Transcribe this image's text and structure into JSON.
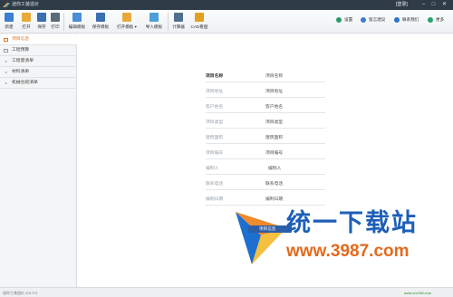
{
  "window": {
    "title": "迷你工装造价",
    "login": "[登录]",
    "controls": {
      "minimize": "–",
      "maximize": "□",
      "close": "✕"
    }
  },
  "toolbar": {
    "buttons": [
      {
        "label": "新建",
        "icon": "new-file-icon",
        "color": "#3c7fd0"
      },
      {
        "label": "打开",
        "icon": "folder-open-icon",
        "color": "#e8a93a"
      },
      {
        "label": "保存",
        "icon": "save-icon",
        "color": "#3a6fb0"
      },
      {
        "label": "打印",
        "icon": "printer-icon",
        "color": "#5b6b7a"
      },
      {
        "label": "编辑模板",
        "icon": "edit-template-icon",
        "color": "#4a8ed6"
      },
      {
        "label": "保存模板",
        "icon": "save-template-icon",
        "color": "#3a6fb0"
      },
      {
        "label": "打开模板 ▾",
        "icon": "open-template-icon",
        "color": "#e8a93a"
      },
      {
        "label": "导入模板",
        "icon": "import-template-icon",
        "color": "#4aa0d8"
      },
      {
        "label": "计算器",
        "icon": "calculator-icon",
        "color": "#4f6f8f"
      },
      {
        "label": "CAD看图",
        "icon": "cad-viewer-icon",
        "color": "#e0a020"
      }
    ],
    "right_links": [
      {
        "label": "设置",
        "icon": "gear-icon",
        "color": "#2e9a6a"
      },
      {
        "label": "留言建议",
        "icon": "message-icon",
        "color": "#3a7fc8"
      },
      {
        "label": "联系我们",
        "icon": "contact-icon",
        "color": "#2b74c9"
      },
      {
        "label": "更多",
        "icon": "more-icon",
        "color": "#26a36a"
      }
    ]
  },
  "sidebar": {
    "items": [
      {
        "label": "项目信息",
        "active": true,
        "kind": "page"
      },
      {
        "label": "工程预算",
        "active": false,
        "kind": "page"
      },
      {
        "label": "工程量清单",
        "active": false,
        "kind": "group"
      },
      {
        "label": "材料清单",
        "active": false,
        "kind": "group"
      },
      {
        "label": "机械台班清单",
        "active": false,
        "kind": "group"
      }
    ]
  },
  "form": {
    "rows": [
      {
        "label": "项目名称",
        "value": "项目名称"
      },
      {
        "label": "项目地址",
        "value": "项目地址"
      },
      {
        "label": "客户姓名",
        "value": "客户姓名"
      },
      {
        "label": "项目类型",
        "value": "项目类型"
      },
      {
        "label": "建筑面积",
        "value": "建筑面积"
      },
      {
        "label": "项目编号",
        "value": "项目编号"
      },
      {
        "label": "编制人",
        "value": "编制人"
      },
      {
        "label": "联系电话",
        "value": "联系电话"
      },
      {
        "label": "编制日期",
        "value": "编制日期"
      }
    ]
  },
  "statusbar": {
    "left": "迷你工装造价 2017V1",
    "right": "www.xm168.com"
  },
  "watermark": {
    "tag": "项目信息",
    "main": "统一下载站",
    "sub": "www.3987.com"
  }
}
